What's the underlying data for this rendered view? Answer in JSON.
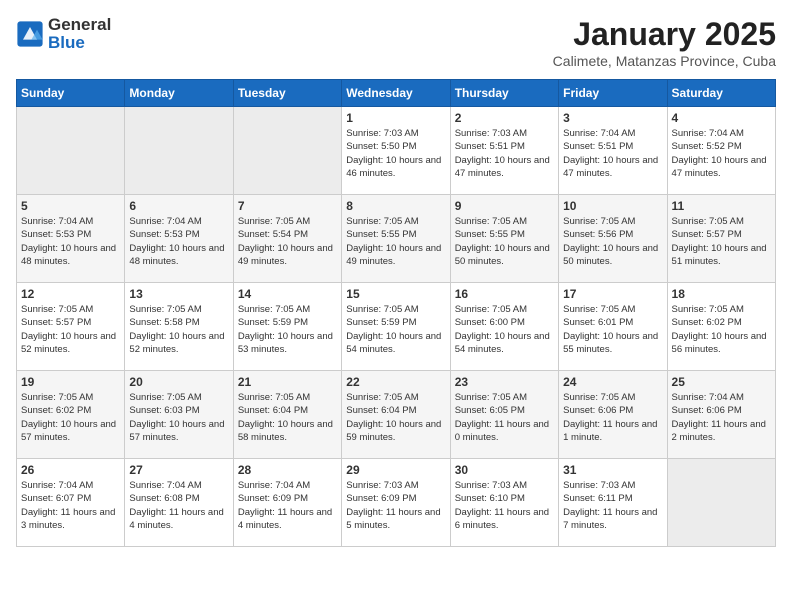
{
  "header": {
    "logo_general": "General",
    "logo_blue": "Blue",
    "title": "January 2025",
    "subtitle": "Calimete, Matanzas Province, Cuba"
  },
  "days_of_week": [
    "Sunday",
    "Monday",
    "Tuesday",
    "Wednesday",
    "Thursday",
    "Friday",
    "Saturday"
  ],
  "weeks": [
    [
      {
        "day": null
      },
      {
        "day": null
      },
      {
        "day": null
      },
      {
        "day": 1,
        "sunrise": "7:03 AM",
        "sunset": "5:50 PM",
        "daylight": "10 hours and 46 minutes."
      },
      {
        "day": 2,
        "sunrise": "7:03 AM",
        "sunset": "5:51 PM",
        "daylight": "10 hours and 47 minutes."
      },
      {
        "day": 3,
        "sunrise": "7:04 AM",
        "sunset": "5:51 PM",
        "daylight": "10 hours and 47 minutes."
      },
      {
        "day": 4,
        "sunrise": "7:04 AM",
        "sunset": "5:52 PM",
        "daylight": "10 hours and 47 minutes."
      }
    ],
    [
      {
        "day": 5,
        "sunrise": "7:04 AM",
        "sunset": "5:53 PM",
        "daylight": "10 hours and 48 minutes."
      },
      {
        "day": 6,
        "sunrise": "7:04 AM",
        "sunset": "5:53 PM",
        "daylight": "10 hours and 48 minutes."
      },
      {
        "day": 7,
        "sunrise": "7:05 AM",
        "sunset": "5:54 PM",
        "daylight": "10 hours and 49 minutes."
      },
      {
        "day": 8,
        "sunrise": "7:05 AM",
        "sunset": "5:55 PM",
        "daylight": "10 hours and 49 minutes."
      },
      {
        "day": 9,
        "sunrise": "7:05 AM",
        "sunset": "5:55 PM",
        "daylight": "10 hours and 50 minutes."
      },
      {
        "day": 10,
        "sunrise": "7:05 AM",
        "sunset": "5:56 PM",
        "daylight": "10 hours and 50 minutes."
      },
      {
        "day": 11,
        "sunrise": "7:05 AM",
        "sunset": "5:57 PM",
        "daylight": "10 hours and 51 minutes."
      }
    ],
    [
      {
        "day": 12,
        "sunrise": "7:05 AM",
        "sunset": "5:57 PM",
        "daylight": "10 hours and 52 minutes."
      },
      {
        "day": 13,
        "sunrise": "7:05 AM",
        "sunset": "5:58 PM",
        "daylight": "10 hours and 52 minutes."
      },
      {
        "day": 14,
        "sunrise": "7:05 AM",
        "sunset": "5:59 PM",
        "daylight": "10 hours and 53 minutes."
      },
      {
        "day": 15,
        "sunrise": "7:05 AM",
        "sunset": "5:59 PM",
        "daylight": "10 hours and 54 minutes."
      },
      {
        "day": 16,
        "sunrise": "7:05 AM",
        "sunset": "6:00 PM",
        "daylight": "10 hours and 54 minutes."
      },
      {
        "day": 17,
        "sunrise": "7:05 AM",
        "sunset": "6:01 PM",
        "daylight": "10 hours and 55 minutes."
      },
      {
        "day": 18,
        "sunrise": "7:05 AM",
        "sunset": "6:02 PM",
        "daylight": "10 hours and 56 minutes."
      }
    ],
    [
      {
        "day": 19,
        "sunrise": "7:05 AM",
        "sunset": "6:02 PM",
        "daylight": "10 hours and 57 minutes."
      },
      {
        "day": 20,
        "sunrise": "7:05 AM",
        "sunset": "6:03 PM",
        "daylight": "10 hours and 57 minutes."
      },
      {
        "day": 21,
        "sunrise": "7:05 AM",
        "sunset": "6:04 PM",
        "daylight": "10 hours and 58 minutes."
      },
      {
        "day": 22,
        "sunrise": "7:05 AM",
        "sunset": "6:04 PM",
        "daylight": "10 hours and 59 minutes."
      },
      {
        "day": 23,
        "sunrise": "7:05 AM",
        "sunset": "6:05 PM",
        "daylight": "11 hours and 0 minutes."
      },
      {
        "day": 24,
        "sunrise": "7:05 AM",
        "sunset": "6:06 PM",
        "daylight": "11 hours and 1 minute."
      },
      {
        "day": 25,
        "sunrise": "7:04 AM",
        "sunset": "6:06 PM",
        "daylight": "11 hours and 2 minutes."
      }
    ],
    [
      {
        "day": 26,
        "sunrise": "7:04 AM",
        "sunset": "6:07 PM",
        "daylight": "11 hours and 3 minutes."
      },
      {
        "day": 27,
        "sunrise": "7:04 AM",
        "sunset": "6:08 PM",
        "daylight": "11 hours and 4 minutes."
      },
      {
        "day": 28,
        "sunrise": "7:04 AM",
        "sunset": "6:09 PM",
        "daylight": "11 hours and 4 minutes."
      },
      {
        "day": 29,
        "sunrise": "7:03 AM",
        "sunset": "6:09 PM",
        "daylight": "11 hours and 5 minutes."
      },
      {
        "day": 30,
        "sunrise": "7:03 AM",
        "sunset": "6:10 PM",
        "daylight": "11 hours and 6 minutes."
      },
      {
        "day": 31,
        "sunrise": "7:03 AM",
        "sunset": "6:11 PM",
        "daylight": "11 hours and 7 minutes."
      },
      {
        "day": null
      }
    ]
  ]
}
